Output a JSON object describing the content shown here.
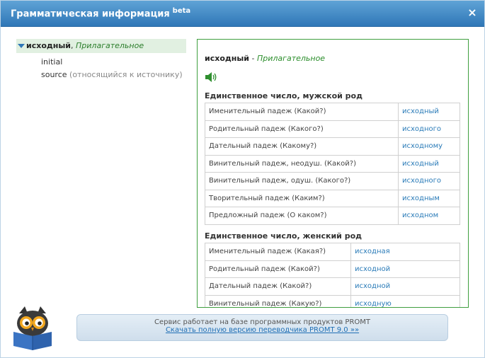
{
  "dialog": {
    "title": "Грамматическая информация",
    "beta": "beta",
    "close_symbol": "×"
  },
  "tree": {
    "word": "исходный",
    "separator": ", ",
    "pos": "Прилагательное",
    "items": [
      {
        "text": "initial",
        "note": ""
      },
      {
        "text": "source",
        "note": " (относящийся к источнику)"
      }
    ]
  },
  "panel": {
    "word": "исходный",
    "dash": " - ",
    "pos": "Прилагательное",
    "speaker_icon": "speaker-icon",
    "sections": [
      {
        "title": "Единственное число, мужской род",
        "rows": [
          {
            "case": "Именительный падеж (Какой?)",
            "form": "исходный"
          },
          {
            "case": "Родительный падеж (Какого?)",
            "form": "исходного"
          },
          {
            "case": "Дательный падеж (Какому?)",
            "form": "исходному"
          },
          {
            "case": "Винительный падеж, неодуш. (Какой?)",
            "form": "исходный"
          },
          {
            "case": "Винительный падеж, одуш. (Какого?)",
            "form": "исходного"
          },
          {
            "case": "Творительный падеж (Каким?)",
            "form": "исходным"
          },
          {
            "case": "Предложный падеж (О каком?)",
            "form": "исходном"
          }
        ]
      },
      {
        "title": "Единственное число, женский род",
        "rows": [
          {
            "case": "Именительный падеж (Какая?)",
            "form": "исходная"
          },
          {
            "case": "Родительный падеж (Какой?)",
            "form": "исходной"
          },
          {
            "case": "Дательный падеж (Какой?)",
            "form": "исходной"
          },
          {
            "case": "Винительный падеж (Какую?)",
            "form": "исходную"
          }
        ]
      }
    ]
  },
  "footer": {
    "line1": "Сервис работает на базе программных продуктов PROMT",
    "link": "Скачать полную версию переводчика PROMT 9.0 »»"
  },
  "colors": {
    "titlebar": "#3a86c6",
    "accent_green": "#3f9f3f",
    "link_blue": "#2a7bb8"
  }
}
